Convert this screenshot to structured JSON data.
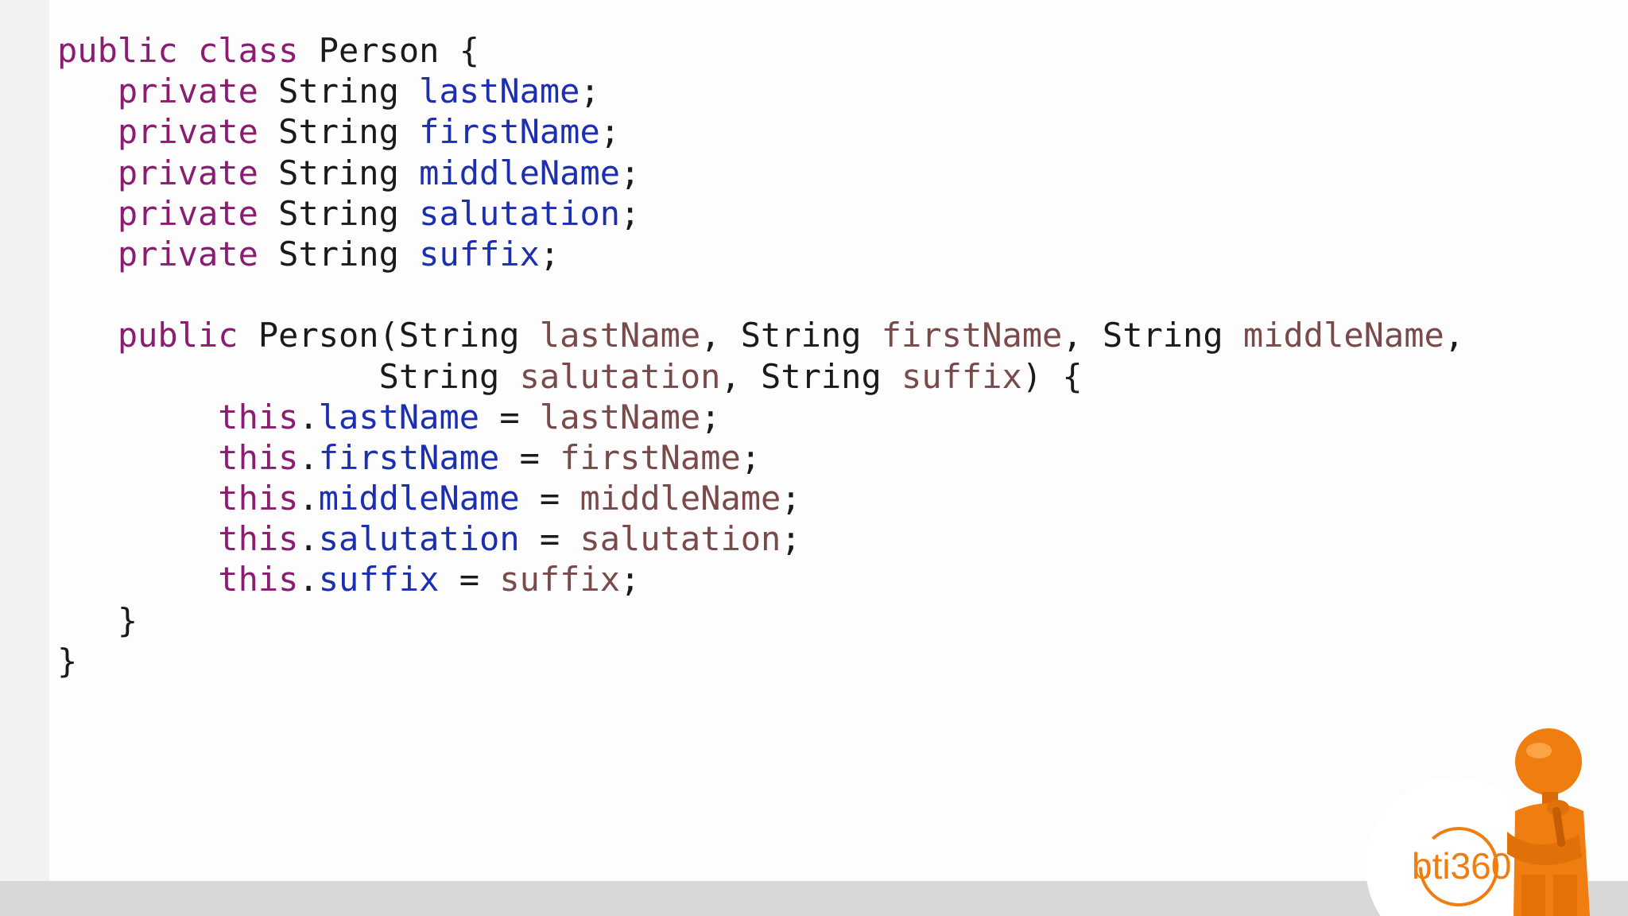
{
  "code": {
    "lines": [
      [
        {
          "t": "public class ",
          "c": "kw"
        },
        {
          "t": "Person {",
          "c": "plain"
        }
      ],
      [
        {
          "t": "   ",
          "c": "plain"
        },
        {
          "t": "private ",
          "c": "kw"
        },
        {
          "t": "String ",
          "c": "plain"
        },
        {
          "t": "lastName",
          "c": "fld"
        },
        {
          "t": ";",
          "c": "plain"
        }
      ],
      [
        {
          "t": "   ",
          "c": "plain"
        },
        {
          "t": "private ",
          "c": "kw"
        },
        {
          "t": "String ",
          "c": "plain"
        },
        {
          "t": "firstName",
          "c": "fld"
        },
        {
          "t": ";",
          "c": "plain"
        }
      ],
      [
        {
          "t": "   ",
          "c": "plain"
        },
        {
          "t": "private ",
          "c": "kw"
        },
        {
          "t": "String ",
          "c": "plain"
        },
        {
          "t": "middleName",
          "c": "fld"
        },
        {
          "t": ";",
          "c": "plain"
        }
      ],
      [
        {
          "t": "   ",
          "c": "plain"
        },
        {
          "t": "private ",
          "c": "kw"
        },
        {
          "t": "String ",
          "c": "plain"
        },
        {
          "t": "salutation",
          "c": "fld"
        },
        {
          "t": ";",
          "c": "plain"
        }
      ],
      [
        {
          "t": "   ",
          "c": "plain"
        },
        {
          "t": "private ",
          "c": "kw"
        },
        {
          "t": "String ",
          "c": "plain"
        },
        {
          "t": "suffix",
          "c": "fld"
        },
        {
          "t": ";",
          "c": "plain"
        }
      ],
      [],
      [
        {
          "t": "   ",
          "c": "plain"
        },
        {
          "t": "public ",
          "c": "kw"
        },
        {
          "t": "Person(String ",
          "c": "plain"
        },
        {
          "t": "lastName",
          "c": "par"
        },
        {
          "t": ", String ",
          "c": "plain"
        },
        {
          "t": "firstName",
          "c": "par"
        },
        {
          "t": ", String ",
          "c": "plain"
        },
        {
          "t": "middleName",
          "c": "par"
        },
        {
          "t": ",",
          "c": "plain"
        }
      ],
      [
        {
          "t": "                String ",
          "c": "plain"
        },
        {
          "t": "salutation",
          "c": "par"
        },
        {
          "t": ", String ",
          "c": "plain"
        },
        {
          "t": "suffix",
          "c": "par"
        },
        {
          "t": ") {",
          "c": "plain"
        }
      ],
      [
        {
          "t": "        ",
          "c": "plain"
        },
        {
          "t": "this",
          "c": "kw"
        },
        {
          "t": ".",
          "c": "plain"
        },
        {
          "t": "lastName",
          "c": "fld"
        },
        {
          "t": " = ",
          "c": "plain"
        },
        {
          "t": "lastName",
          "c": "par"
        },
        {
          "t": ";",
          "c": "plain"
        }
      ],
      [
        {
          "t": "        ",
          "c": "plain"
        },
        {
          "t": "this",
          "c": "kw"
        },
        {
          "t": ".",
          "c": "plain"
        },
        {
          "t": "firstName",
          "c": "fld"
        },
        {
          "t": " = ",
          "c": "plain"
        },
        {
          "t": "firstName",
          "c": "par"
        },
        {
          "t": ";",
          "c": "plain"
        }
      ],
      [
        {
          "t": "        ",
          "c": "plain"
        },
        {
          "t": "this",
          "c": "kw"
        },
        {
          "t": ".",
          "c": "plain"
        },
        {
          "t": "middleName",
          "c": "fld"
        },
        {
          "t": " = ",
          "c": "plain"
        },
        {
          "t": "middleName",
          "c": "par"
        },
        {
          "t": ";",
          "c": "plain"
        }
      ],
      [
        {
          "t": "        ",
          "c": "plain"
        },
        {
          "t": "this",
          "c": "kw"
        },
        {
          "t": ".",
          "c": "plain"
        },
        {
          "t": "salutation",
          "c": "fld"
        },
        {
          "t": " = ",
          "c": "plain"
        },
        {
          "t": "salutation",
          "c": "par"
        },
        {
          "t": ";",
          "c": "plain"
        }
      ],
      [
        {
          "t": "        ",
          "c": "plain"
        },
        {
          "t": "this",
          "c": "kw"
        },
        {
          "t": ".",
          "c": "plain"
        },
        {
          "t": "suffix",
          "c": "fld"
        },
        {
          "t": " = ",
          "c": "plain"
        },
        {
          "t": "suffix",
          "c": "par"
        },
        {
          "t": ";",
          "c": "plain"
        }
      ],
      [
        {
          "t": "   }",
          "c": "plain"
        }
      ],
      [
        {
          "t": "}",
          "c": "plain"
        }
      ]
    ]
  },
  "logo": {
    "text": "bti360",
    "brand_color": "#f07d10",
    "icon_name": "presenter-figure-icon"
  },
  "colors": {
    "keyword": "#8b1c72",
    "field": "#1c2fb0",
    "parameter": "#7a4a4a",
    "plain": "#1a1a1a"
  }
}
